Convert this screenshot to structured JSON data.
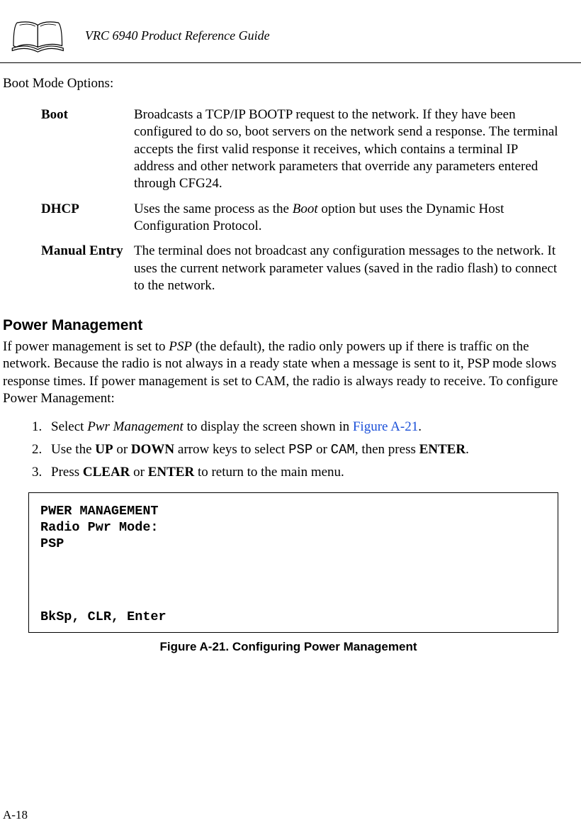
{
  "header": {
    "title": "VRC 6940 Product Reference Guide"
  },
  "bootModeTitle": "Boot Mode Options:",
  "bootOptions": [
    {
      "term": "Boot",
      "desc": "Broadcasts a TCP/IP BOOTP request to the network. If they have been configured to do so, boot servers on the network send a response. The terminal accepts the first valid response it receives, which contains a terminal IP address and other network parameters that override any parameters entered through CFG24."
    },
    {
      "term": "DHCP",
      "desc_pre": "Uses the same process as the ",
      "desc_em": "Boot",
      "desc_post": " option but uses the Dynamic Host Configuration Protocol."
    },
    {
      "term": "Manual Entry",
      "desc": "The terminal does not broadcast any configuration messages to the network. It uses the current network parameter values (saved in the radio flash) to connect to the network."
    }
  ],
  "section": {
    "heading": "Power Management",
    "para_pre": "If power management is set to ",
    "para_em": "PSP",
    "para_post": " (the default), the radio only powers up if there is traffic on the network. Because the radio is not always in a ready state when a message is sent to it, PSP mode slows response times. If power management is set to CAM, the radio is always ready to receive. To configure Power Management:"
  },
  "steps": {
    "s1_pre": "Select ",
    "s1_em": "Pwr Management",
    "s1_mid": " to display the screen shown in ",
    "s1_link": "Figure A-21",
    "s1_post": ".",
    "s2_pre": "Use the ",
    "s2_b1": "UP",
    "s2_mid1": " or ",
    "s2_b2": "DOWN",
    "s2_mid2": " arrow keys to select ",
    "s2_m1": "PSP",
    "s2_mid3": " or ",
    "s2_m2": "CAM",
    "s2_mid4": ", then press ",
    "s2_b3": "ENTER",
    "s2_post": ".",
    "s3_pre": "Press ",
    "s3_b1": "CLEAR",
    "s3_mid": " or ",
    "s3_b2": "ENTER",
    "s3_post": " to return to the main menu."
  },
  "screen": {
    "line1": "PWER MANAGEMENT",
    "line2": "Radio Pwr Mode:",
    "line3": "PSP",
    "footer": "BkSp, CLR, Enter"
  },
  "figureCaption": "Figure A-21.  Configuring Power Management",
  "pageNumber": "A-18"
}
